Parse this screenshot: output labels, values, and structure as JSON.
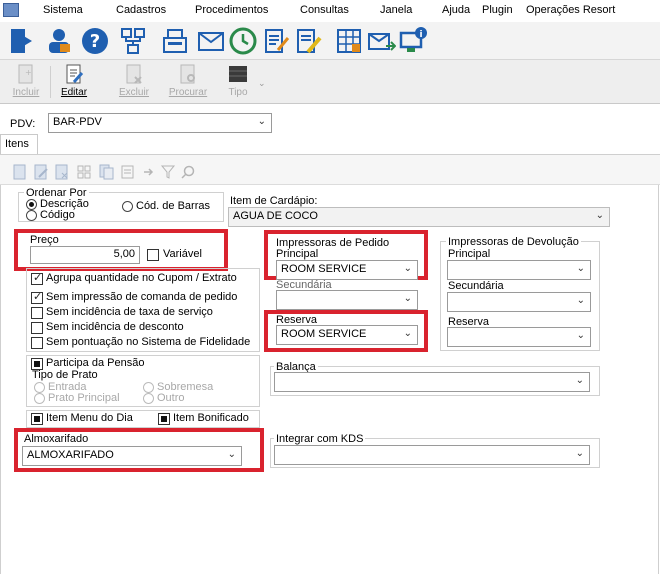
{
  "menu": [
    "Sistema",
    "Cadastros",
    "Procedimentos",
    "Consultas",
    "Janela",
    "Ajuda",
    "Plugin",
    "Operações Resort"
  ],
  "toolbar2": {
    "incluir": "Incluir",
    "editar": "Editar",
    "excluir": "Excluir",
    "procurar": "Procurar",
    "tipo": "Tipo"
  },
  "pdv": {
    "label": "PDV:",
    "value": "BAR-PDV"
  },
  "tab_itens": "Itens",
  "ordenar": {
    "title": "Ordenar Por",
    "descricao": "Descrição",
    "codigo": "Código",
    "cod_barras": "Cód. de Barras",
    "selected": "Descrição"
  },
  "item_cardapio": {
    "label": "Item de Cardápio:",
    "value": "AGUA DE COCO"
  },
  "preco": {
    "label": "Preço",
    "value": "5,00",
    "variavel": "Variável",
    "variavel_checked": false
  },
  "checks": [
    {
      "label": "Agrupa quantidade no Cupom / Extrato",
      "checked": true
    },
    {
      "label": "Sem impressão de comanda de pedido",
      "checked": true
    },
    {
      "label": "Sem incidência de taxa de serviço",
      "checked": false
    },
    {
      "label": "Sem incidência de desconto",
      "checked": false
    },
    {
      "label": "Sem pontuação no Sistema de Fidelidade",
      "checked": false
    }
  ],
  "pensao": {
    "participa": "Participa da Pensão",
    "tipo_prato": "Tipo de Prato",
    "entrada": "Entrada",
    "sobremesa": "Sobremesa",
    "prato_principal": "Prato Principal",
    "outro": "Outro"
  },
  "item_menu_dia": "Item Menu do Dia",
  "item_bonificado": "Item Bonificado",
  "almoxarifado": {
    "label": "Almoxarifado",
    "value": "ALMOXARIFADO"
  },
  "impressoras_pedido": {
    "title": "Impressoras de Pedido",
    "principal_label": "Principal",
    "principal_value": "ROOM SERVICE",
    "secundaria_label": "Secundária",
    "secundaria_value": "",
    "reserva_label": "Reserva",
    "reserva_value": "ROOM SERVICE"
  },
  "impressoras_devolucao": {
    "title": "Impressoras de Devolução",
    "principal_label": "Principal",
    "principal_value": "",
    "secundaria_label": "Secundária",
    "secundaria_value": "",
    "reserva_label": "Reserva",
    "reserva_value": ""
  },
  "balanca": {
    "label": "Balança",
    "value": ""
  },
  "kds": {
    "label": "Integrar com KDS",
    "value": ""
  },
  "colors": {
    "highlight": "#d9232e",
    "blue_icon": "#1f5fb0"
  }
}
